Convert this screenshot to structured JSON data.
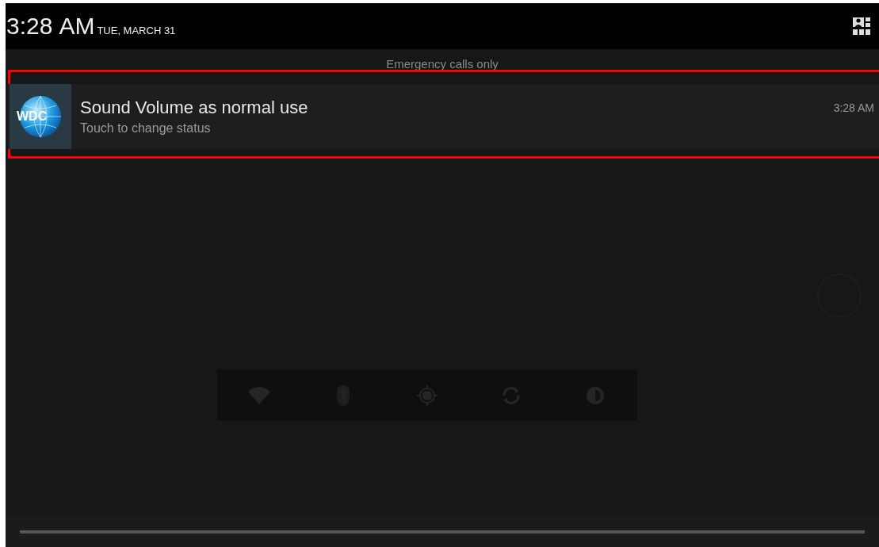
{
  "status_bar": {
    "time": "3:28",
    "ampm": "AM",
    "date": "TUE, MARCH 31"
  },
  "carrier_label": "Emergency calls only",
  "notifications": [
    {
      "title": "Sound Volume as normal use",
      "text": "Touch to change status",
      "time": "3:28 AM",
      "icon_label": "WDC",
      "highlighted": true
    }
  ],
  "quick_settings": [
    {
      "kind": "wifi"
    },
    {
      "kind": "bluetooth"
    },
    {
      "kind": "location"
    },
    {
      "kind": "sync"
    },
    {
      "kind": "brightness"
    }
  ]
}
